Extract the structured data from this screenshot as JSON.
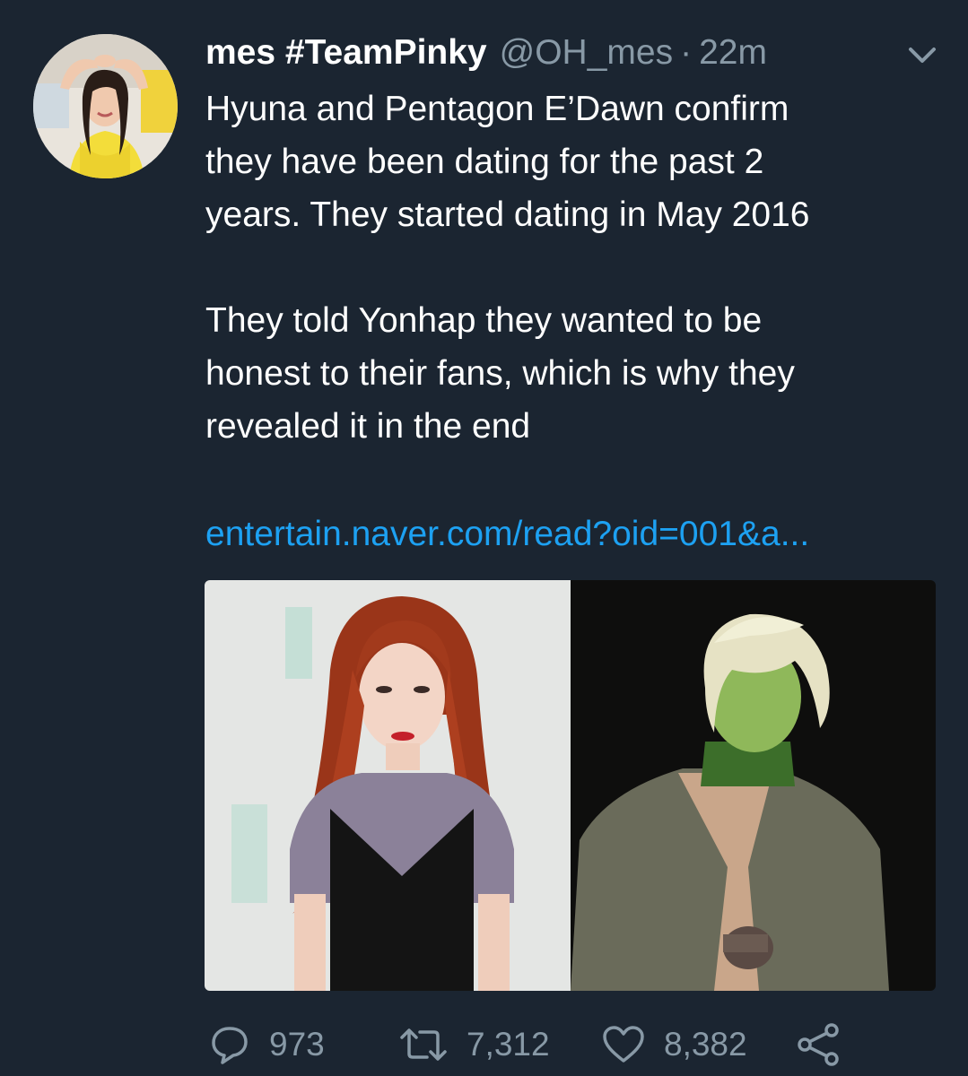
{
  "tweet": {
    "display_name": "mes #TeamPinky",
    "handle": "@OH_mes",
    "separator": "·",
    "time": "22m",
    "paragraphs": [
      "Hyuna and Pentagon E’Dawn confirm\nthey have been dating for the past 2\nyears. They started dating in May 2016",
      "They told Yonhap they wanted to be\nhonest to their fans, which is why they\nrevealed it in the end"
    ],
    "link_text": "entertain.naver.com/read?oid=001&a..."
  },
  "actions": {
    "reply_count": "973",
    "retweet_count": "7,312",
    "like_count": "8,382"
  },
  "icons": {
    "menu": "chevron-down-icon",
    "reply": "reply-icon",
    "retweet": "retweet-icon",
    "like": "heart-icon",
    "share": "share-icon"
  },
  "colors": {
    "background": "#1b2531",
    "text": "#ffffff",
    "secondary": "#8899a6",
    "link": "#1da1f2"
  }
}
